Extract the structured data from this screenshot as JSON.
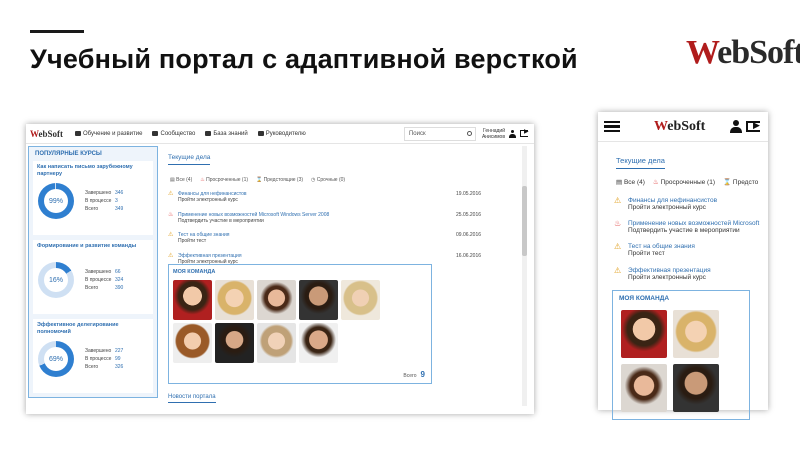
{
  "slide": {
    "title": "Учебный портал с адаптивной версткой",
    "logo_w": "W",
    "logo_rest": "ebSoft"
  },
  "desktop": {
    "logo_w": "W",
    "logo_rest": "ebSoft",
    "nav": [
      "Обучение и развитие",
      "Сообщество",
      "База знаний",
      "Руководителю"
    ],
    "search_placeholder": "Поиск",
    "user_line1": "Геннадий",
    "user_line2": "Анисимов",
    "sidebar_title": "ПОПУЛЯРНЫЕ КУРСЫ",
    "courses": [
      {
        "title": "Как написать письмо зарубежному партнеру",
        "percent": "99%",
        "progress": 0.99,
        "stats": [
          [
            "Завершено",
            "346"
          ],
          [
            "В процессе",
            "3"
          ],
          [
            "Всего",
            "349"
          ]
        ]
      },
      {
        "title": "Формирование и развитие команды",
        "percent": "16%",
        "progress": 0.16,
        "stats": [
          [
            "Завершено",
            "66"
          ],
          [
            "В процессе",
            "324"
          ],
          [
            "Всего",
            "390"
          ]
        ]
      },
      {
        "title": "Эффективное делегирование полномочий",
        "percent": "69%",
        "progress": 0.69,
        "stats": [
          [
            "Завершено",
            "227"
          ],
          [
            "В процессе",
            "99"
          ],
          [
            "Всего",
            "326"
          ]
        ]
      }
    ],
    "tab_current": "Текущие дела",
    "filters": [
      "Все (4)",
      "Просроченные (1)",
      "Предстоящие (3)",
      "Срочные (0)"
    ],
    "tasks": [
      {
        "title": "Финансы для нефинансистов",
        "sub": "Пройти электронный курс",
        "date": "19.05.2016",
        "urgent": false
      },
      {
        "title": "Применение новых возможностей Microsoft Windows Server 2008",
        "sub": "Подтвердить участие в мероприятии",
        "date": "25.05.2016",
        "urgent": true
      },
      {
        "title": "Тест на общие знания",
        "sub": "Пройти тест",
        "date": "09.06.2016",
        "urgent": false
      },
      {
        "title": "Эффективная презентация",
        "sub": "Пройти электронный курс",
        "date": "16.06.2016",
        "urgent": false
      }
    ],
    "team_title": "МОЯ КОМАНДА",
    "team_footer_label": "Всего",
    "team_total": "9",
    "news_tab": "Новости портала"
  },
  "mobile": {
    "logo_w": "W",
    "logo_rest": "ebSoft",
    "tab_current": "Текущие дела",
    "filters": [
      "Все (4)",
      "Просроченные (1)",
      "Предсто"
    ],
    "tasks": [
      {
        "title": "Финансы для нефинансистов",
        "sub": "Пройти электронный курс",
        "urgent": false
      },
      {
        "title": "Применение новых возможностей Microsoft",
        "sub": "Подтвердить участие в мероприятии",
        "urgent": true
      },
      {
        "title": "Тест на общие знания",
        "sub": "Пройти тест",
        "urgent": false
      },
      {
        "title": "Эффективная презентация",
        "sub": "Пройти электронный курс",
        "urgent": false
      }
    ],
    "team_title": "МОЯ КОМАНДА"
  },
  "colors": {
    "accent": "#2f6fb0",
    "brand": "#b01c1c",
    "donut": "#2f7fd0"
  }
}
